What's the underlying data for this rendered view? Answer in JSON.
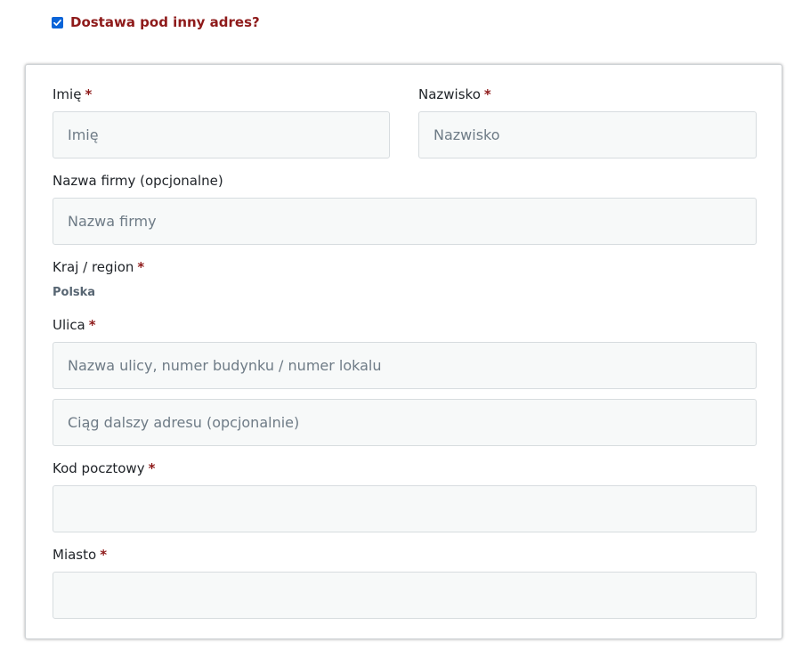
{
  "ship_to_different": {
    "label": "Dostawa pod inny adres?",
    "checked": true
  },
  "form": {
    "required_mark": "*",
    "first_name": {
      "label": "Imię",
      "placeholder": "Imię",
      "value": ""
    },
    "last_name": {
      "label": "Nazwisko",
      "placeholder": "Nazwisko",
      "value": ""
    },
    "company": {
      "label": "Nazwa firmy (opcjonalne)",
      "placeholder": "Nazwa firmy",
      "value": ""
    },
    "country": {
      "label": "Kraj / region",
      "value": "Polska"
    },
    "street": {
      "label": "Ulica",
      "placeholder_1": "Nazwa ulicy, numer budynku / numer lokalu",
      "placeholder_2": "Ciąg dalszy adresu (opcjonalnie)"
    },
    "postcode": {
      "label": "Kod pocztowy",
      "placeholder": "",
      "value": ""
    },
    "city": {
      "label": "Miasto",
      "placeholder": "",
      "value": ""
    }
  },
  "colors": {
    "accent": "#8e1a1a",
    "checkbox": "#0a64d8",
    "field_bg": "#f7f9f9",
    "field_border": "#d7dcdf",
    "placeholder": "#6e7b86"
  },
  "icons": {
    "checkbox": "check-icon"
  }
}
